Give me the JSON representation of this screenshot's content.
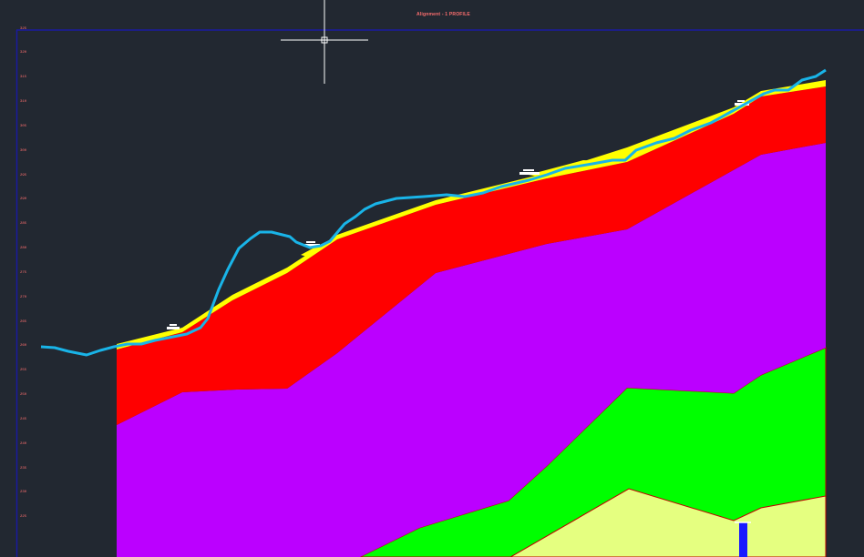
{
  "title": "Alignment - 1 PROFILE",
  "axis": {
    "tick_labels": [
      "325",
      "320",
      "315",
      "310",
      "305",
      "300",
      "295",
      "290",
      "285",
      "280",
      "275",
      "270",
      "265",
      "260",
      "255",
      "250",
      "245",
      "240",
      "235",
      "230",
      "225"
    ]
  },
  "colors": {
    "background": "#222831",
    "frame": "#1a1aa0",
    "ground_line": "#19b4e8",
    "layer_yellow": "#ffff00",
    "layer_red": "#ff0000",
    "layer_purple": "#bb00ff",
    "layer_green": "#00ff00",
    "layer_pale": "#e5ff80",
    "marker": "#1a1aff",
    "label_text": "#ff6f6f"
  },
  "cursor": "crosshair-cursor"
}
